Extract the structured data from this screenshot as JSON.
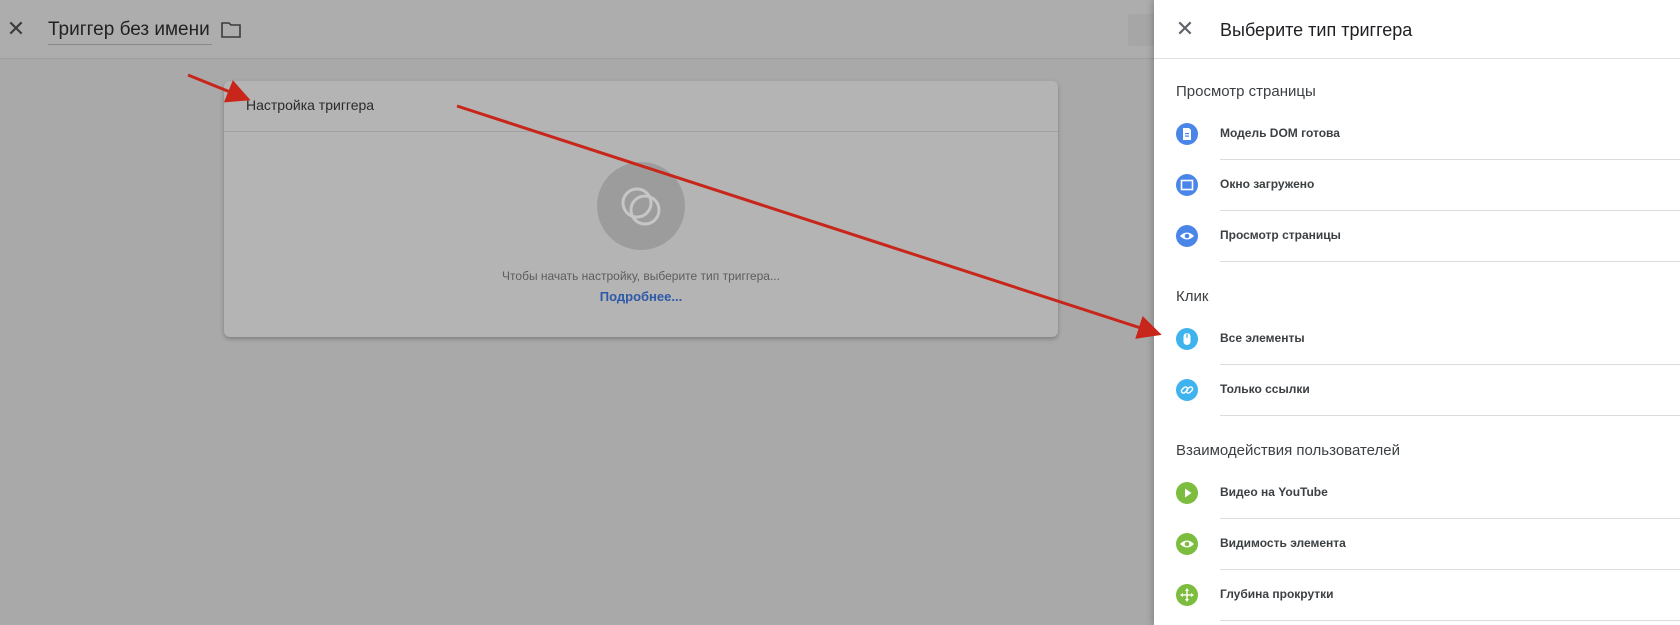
{
  "editor": {
    "close_icon": "close-icon",
    "title": "Триггер без имени",
    "folder_icon": "folder-icon",
    "card": {
      "title": "Настройка триггера",
      "hint": "Чтобы начать настройку, выберите тип триггера...",
      "learn_more": "Подробнее..."
    }
  },
  "drawer": {
    "title": "Выберите тип триггера",
    "sections": [
      {
        "title": "Просмотр страницы",
        "items": [
          {
            "label": "Модель DOM готова",
            "icon": "document-icon",
            "color": "#4a86e8"
          },
          {
            "label": "Окно загружено",
            "icon": "window-icon",
            "color": "#4a86e8"
          },
          {
            "label": "Просмотр страницы",
            "icon": "eye-icon",
            "color": "#4a86e8"
          }
        ]
      },
      {
        "title": "Клик",
        "items": [
          {
            "label": "Все элементы",
            "icon": "mouse-icon",
            "color": "#3fb3ee"
          },
          {
            "label": "Только ссылки",
            "icon": "link-icon",
            "color": "#3fb3ee"
          }
        ]
      },
      {
        "title": "Взаимодействия пользователей",
        "items": [
          {
            "label": "Видео на YouTube",
            "icon": "play-icon",
            "color": "#7cbd3f"
          },
          {
            "label": "Видимость элемента",
            "icon": "eye-icon",
            "color": "#7cbd3f"
          },
          {
            "label": "Глубина прокрутки",
            "icon": "move-arrows-icon",
            "color": "#7cbd3f"
          }
        ]
      }
    ]
  },
  "colors": {
    "annotation_arrow": "#c8261a",
    "link": "#2d5aa8"
  }
}
